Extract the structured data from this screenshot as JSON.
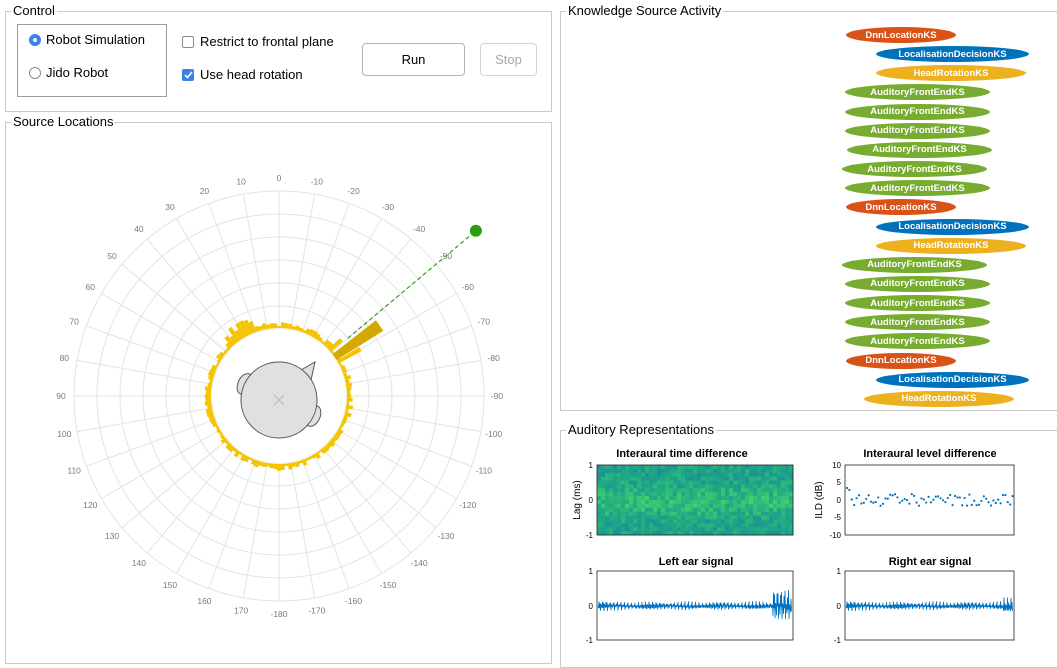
{
  "control": {
    "title": "Control",
    "robot_simulation": "Robot Simulation",
    "jido_robot": "Jido Robot",
    "restrict_label": "Restrict to frontal plane",
    "head_rotation_label": "Use head rotation",
    "run_label": "Run",
    "stop_label": "Stop",
    "selected_source": "Robot Simulation",
    "restrict_checked": false,
    "head_rotation_checked": true,
    "accent": "#3b82e6"
  },
  "source_locations": {
    "title": "Source Locations",
    "angle_labels": [
      "0",
      "-10",
      "-20",
      "-30",
      "-40",
      "-50",
      "-60",
      "-70",
      "-80",
      "-90",
      "-100",
      "-110",
      "-120",
      "-130",
      "-140",
      "-150",
      "-160",
      "-170",
      "-180",
      "170",
      "160",
      "150",
      "140",
      "130",
      "120",
      "110",
      "100",
      "90",
      "80",
      "70",
      "60",
      "50",
      "40",
      "30",
      "20",
      "10"
    ],
    "source_angle_deg": -50,
    "source_color": "#2a9d10",
    "histogram_color": "#f5c400"
  },
  "ks_activity": {
    "title": "Knowledge Source Activity",
    "items": [
      {
        "label": "DnnLocationKS",
        "type": "dnn"
      },
      {
        "label": "LocalisationDecisionKS",
        "type": "decision"
      },
      {
        "label": "HeadRotationKS",
        "type": "head"
      },
      {
        "label": "AuditoryFrontEndKS",
        "type": "afe"
      },
      {
        "label": "AuditoryFrontEndKS",
        "type": "afe"
      },
      {
        "label": "AuditoryFrontEndKS",
        "type": "afe"
      },
      {
        "label": "AuditoryFrontEndKS",
        "type": "afe"
      },
      {
        "label": "AuditoryFrontEndKS",
        "type": "afe"
      },
      {
        "label": "AuditoryFrontEndKS",
        "type": "afe"
      },
      {
        "label": "DnnLocationKS",
        "type": "dnn"
      },
      {
        "label": "LocalisationDecisionKS",
        "type": "decision"
      },
      {
        "label": "HeadRotationKS",
        "type": "head"
      },
      {
        "label": "AuditoryFrontEndKS",
        "type": "afe"
      },
      {
        "label": "AuditoryFrontEndKS",
        "type": "afe"
      },
      {
        "label": "AuditoryFrontEndKS",
        "type": "afe"
      },
      {
        "label": "AuditoryFrontEndKS",
        "type": "afe"
      },
      {
        "label": "AuditoryFrontEndKS",
        "type": "afe"
      },
      {
        "label": "DnnLocationKS",
        "type": "dnn"
      },
      {
        "label": "LocalisationDecisionKS",
        "type": "decision"
      },
      {
        "label": "HeadRotationKS",
        "type": "head"
      }
    ],
    "colors": {
      "dnn": "#d95319",
      "decision": "#0072bd",
      "head": "#edb120",
      "afe": "#77ac30"
    }
  },
  "auditory": {
    "title": "Auditory Representations",
    "itd": {
      "title": "Interaural time difference",
      "ylabel": "Lag (ms)",
      "yticks": [
        "1",
        "0",
        "-1"
      ]
    },
    "ild": {
      "title": "Interaural level difference",
      "ylabel": "ILD (dB)",
      "yticks": [
        "10",
        "5",
        "0",
        "-5",
        "-10"
      ]
    },
    "left": {
      "title": "Left ear signal",
      "yticks": [
        "1",
        "0",
        "-1"
      ]
    },
    "right": {
      "title": "Right ear signal",
      "yticks": [
        "1",
        "0",
        "-1"
      ]
    },
    "line_color": "#0072bd"
  }
}
